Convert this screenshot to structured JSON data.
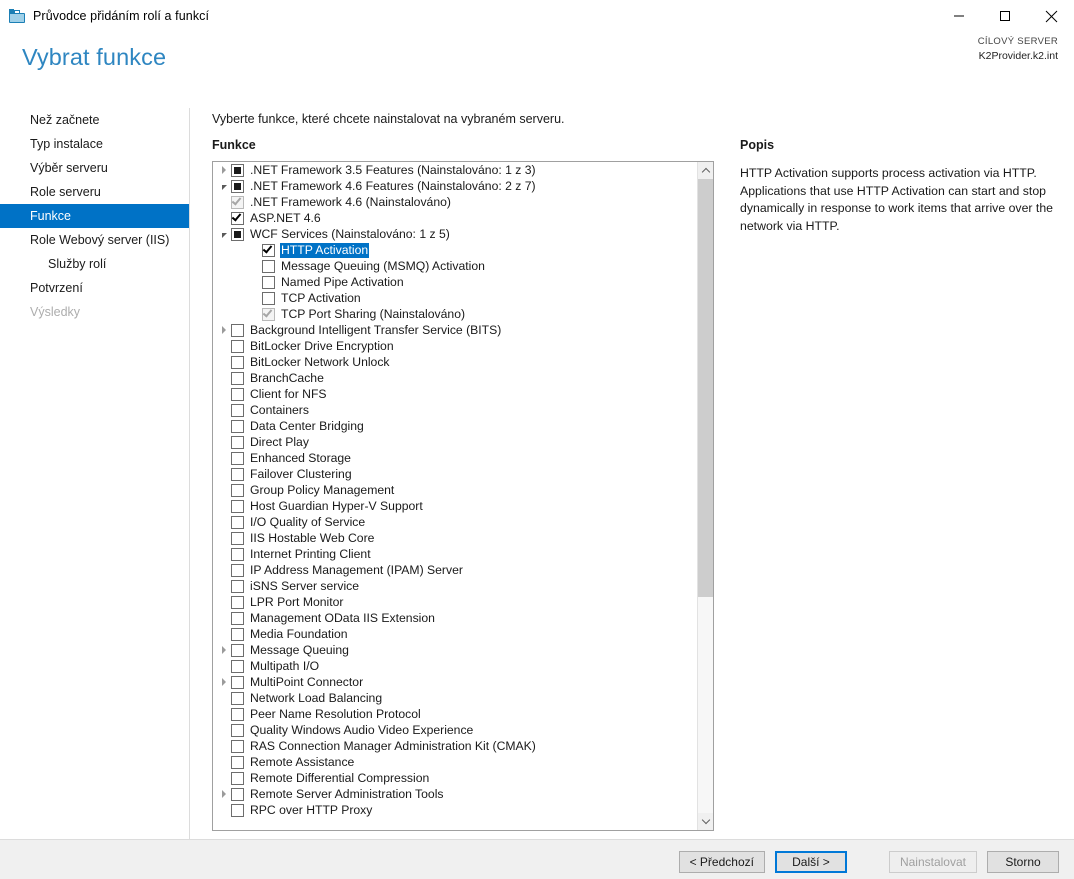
{
  "window": {
    "title": "Průvodce přidáním rolí a funkcí",
    "icon": "toolbox-icon",
    "minimize_label": "–",
    "maximize_label": "□",
    "close_label": "×"
  },
  "header": {
    "page_title": "Vybrat funkce",
    "target_server_label": "CÍLOVÝ SERVER",
    "target_server_value": "K2Provider.k2.int"
  },
  "sidebar": {
    "items": [
      {
        "label": "Než začnete",
        "state": "normal",
        "indent": 0
      },
      {
        "label": "Typ instalace",
        "state": "normal",
        "indent": 0
      },
      {
        "label": "Výběr serveru",
        "state": "normal",
        "indent": 0
      },
      {
        "label": "Role serveru",
        "state": "normal",
        "indent": 0
      },
      {
        "label": "Funkce",
        "state": "active",
        "indent": 0
      },
      {
        "label": "Role Webový server (IIS)",
        "state": "normal",
        "indent": 0
      },
      {
        "label": "Služby rolí",
        "state": "normal",
        "indent": 1
      },
      {
        "label": "Potvrzení",
        "state": "normal",
        "indent": 0
      },
      {
        "label": "Výsledky",
        "state": "disabled",
        "indent": 0
      }
    ]
  },
  "main": {
    "instruction": "Vyberte funkce, které chcete nainstalovat na vybraném serveru.",
    "features_label": "Funkce",
    "description_label": "Popis",
    "description_text": "HTTP Activation supports process activation via HTTP. Applications that use HTTP Activation can start and stop dynamically in response to work items that arrive over the network via HTTP."
  },
  "tree": {
    "rows": [
      {
        "label": ".NET Framework 3.5 Features (Nainstalováno: 1 z 3)",
        "indent": 0,
        "twisty": "collapsed",
        "check": "partial",
        "disabled": false,
        "selected": false
      },
      {
        "label": ".NET Framework 4.6 Features (Nainstalováno: 2 z 7)",
        "indent": 0,
        "twisty": "expanded",
        "check": "partial",
        "disabled": false,
        "selected": false
      },
      {
        "label": ".NET Framework 4.6 (Nainstalováno)",
        "indent": 1,
        "twisty": "none",
        "check": "checked",
        "disabled": true,
        "selected": false
      },
      {
        "label": "ASP.NET 4.6",
        "indent": 1,
        "twisty": "none",
        "check": "checked",
        "disabled": false,
        "selected": false
      },
      {
        "label": "WCF Services (Nainstalováno: 1 z 5)",
        "indent": 1,
        "twisty": "expanded",
        "check": "partial",
        "disabled": false,
        "selected": false
      },
      {
        "label": "HTTP Activation",
        "indent": 2,
        "twisty": "none",
        "check": "checked",
        "disabled": false,
        "selected": true
      },
      {
        "label": "Message Queuing (MSMQ) Activation",
        "indent": 2,
        "twisty": "none",
        "check": "unchecked",
        "disabled": false,
        "selected": false
      },
      {
        "label": "Named Pipe Activation",
        "indent": 2,
        "twisty": "none",
        "check": "unchecked",
        "disabled": false,
        "selected": false
      },
      {
        "label": "TCP Activation",
        "indent": 2,
        "twisty": "none",
        "check": "unchecked",
        "disabled": false,
        "selected": false
      },
      {
        "label": "TCP Port Sharing (Nainstalováno)",
        "indent": 2,
        "twisty": "none",
        "check": "checked",
        "disabled": true,
        "selected": false
      },
      {
        "label": "Background Intelligent Transfer Service (BITS)",
        "indent": 0,
        "twisty": "collapsed",
        "check": "unchecked",
        "disabled": false,
        "selected": false
      },
      {
        "label": "BitLocker Drive Encryption",
        "indent": 0,
        "twisty": "none",
        "check": "unchecked",
        "disabled": false,
        "selected": false
      },
      {
        "label": "BitLocker Network Unlock",
        "indent": 0,
        "twisty": "none",
        "check": "unchecked",
        "disabled": false,
        "selected": false
      },
      {
        "label": "BranchCache",
        "indent": 0,
        "twisty": "none",
        "check": "unchecked",
        "disabled": false,
        "selected": false
      },
      {
        "label": "Client for NFS",
        "indent": 0,
        "twisty": "none",
        "check": "unchecked",
        "disabled": false,
        "selected": false
      },
      {
        "label": "Containers",
        "indent": 0,
        "twisty": "none",
        "check": "unchecked",
        "disabled": false,
        "selected": false
      },
      {
        "label": "Data Center Bridging",
        "indent": 0,
        "twisty": "none",
        "check": "unchecked",
        "disabled": false,
        "selected": false
      },
      {
        "label": "Direct Play",
        "indent": 0,
        "twisty": "none",
        "check": "unchecked",
        "disabled": false,
        "selected": false
      },
      {
        "label": "Enhanced Storage",
        "indent": 0,
        "twisty": "none",
        "check": "unchecked",
        "disabled": false,
        "selected": false
      },
      {
        "label": "Failover Clustering",
        "indent": 0,
        "twisty": "none",
        "check": "unchecked",
        "disabled": false,
        "selected": false
      },
      {
        "label": "Group Policy Management",
        "indent": 0,
        "twisty": "none",
        "check": "unchecked",
        "disabled": false,
        "selected": false
      },
      {
        "label": "Host Guardian Hyper-V Support",
        "indent": 0,
        "twisty": "none",
        "check": "unchecked",
        "disabled": false,
        "selected": false
      },
      {
        "label": "I/O Quality of Service",
        "indent": 0,
        "twisty": "none",
        "check": "unchecked",
        "disabled": false,
        "selected": false
      },
      {
        "label": "IIS Hostable Web Core",
        "indent": 0,
        "twisty": "none",
        "check": "unchecked",
        "disabled": false,
        "selected": false
      },
      {
        "label": "Internet Printing Client",
        "indent": 0,
        "twisty": "none",
        "check": "unchecked",
        "disabled": false,
        "selected": false
      },
      {
        "label": "IP Address Management (IPAM) Server",
        "indent": 0,
        "twisty": "none",
        "check": "unchecked",
        "disabled": false,
        "selected": false
      },
      {
        "label": "iSNS Server service",
        "indent": 0,
        "twisty": "none",
        "check": "unchecked",
        "disabled": false,
        "selected": false
      },
      {
        "label": "LPR Port Monitor",
        "indent": 0,
        "twisty": "none",
        "check": "unchecked",
        "disabled": false,
        "selected": false
      },
      {
        "label": "Management OData IIS Extension",
        "indent": 0,
        "twisty": "none",
        "check": "unchecked",
        "disabled": false,
        "selected": false
      },
      {
        "label": "Media Foundation",
        "indent": 0,
        "twisty": "none",
        "check": "unchecked",
        "disabled": false,
        "selected": false
      },
      {
        "label": "Message Queuing",
        "indent": 0,
        "twisty": "collapsed",
        "check": "unchecked",
        "disabled": false,
        "selected": false
      },
      {
        "label": "Multipath I/O",
        "indent": 0,
        "twisty": "none",
        "check": "unchecked",
        "disabled": false,
        "selected": false
      },
      {
        "label": "MultiPoint Connector",
        "indent": 0,
        "twisty": "collapsed",
        "check": "unchecked",
        "disabled": false,
        "selected": false
      },
      {
        "label": "Network Load Balancing",
        "indent": 0,
        "twisty": "none",
        "check": "unchecked",
        "disabled": false,
        "selected": false
      },
      {
        "label": "Peer Name Resolution Protocol",
        "indent": 0,
        "twisty": "none",
        "check": "unchecked",
        "disabled": false,
        "selected": false
      },
      {
        "label": "Quality Windows Audio Video Experience",
        "indent": 0,
        "twisty": "none",
        "check": "unchecked",
        "disabled": false,
        "selected": false
      },
      {
        "label": "RAS Connection Manager Administration Kit (CMAK)",
        "indent": 0,
        "twisty": "none",
        "check": "unchecked",
        "disabled": false,
        "selected": false
      },
      {
        "label": "Remote Assistance",
        "indent": 0,
        "twisty": "none",
        "check": "unchecked",
        "disabled": false,
        "selected": false
      },
      {
        "label": "Remote Differential Compression",
        "indent": 0,
        "twisty": "none",
        "check": "unchecked",
        "disabled": false,
        "selected": false
      },
      {
        "label": "Remote Server Administration Tools",
        "indent": 0,
        "twisty": "collapsed",
        "check": "unchecked",
        "disabled": false,
        "selected": false
      },
      {
        "label": "RPC over HTTP Proxy",
        "indent": 0,
        "twisty": "none",
        "check": "unchecked",
        "disabled": false,
        "selected": false
      }
    ]
  },
  "footer": {
    "previous_label": "< Předchozí",
    "next_label": "Další >",
    "install_label": "Nainstalovat",
    "cancel_label": "Storno"
  },
  "colors": {
    "accent": "#0072c6",
    "title_blue": "#2e86c1",
    "focus_border": "#0078d7"
  }
}
